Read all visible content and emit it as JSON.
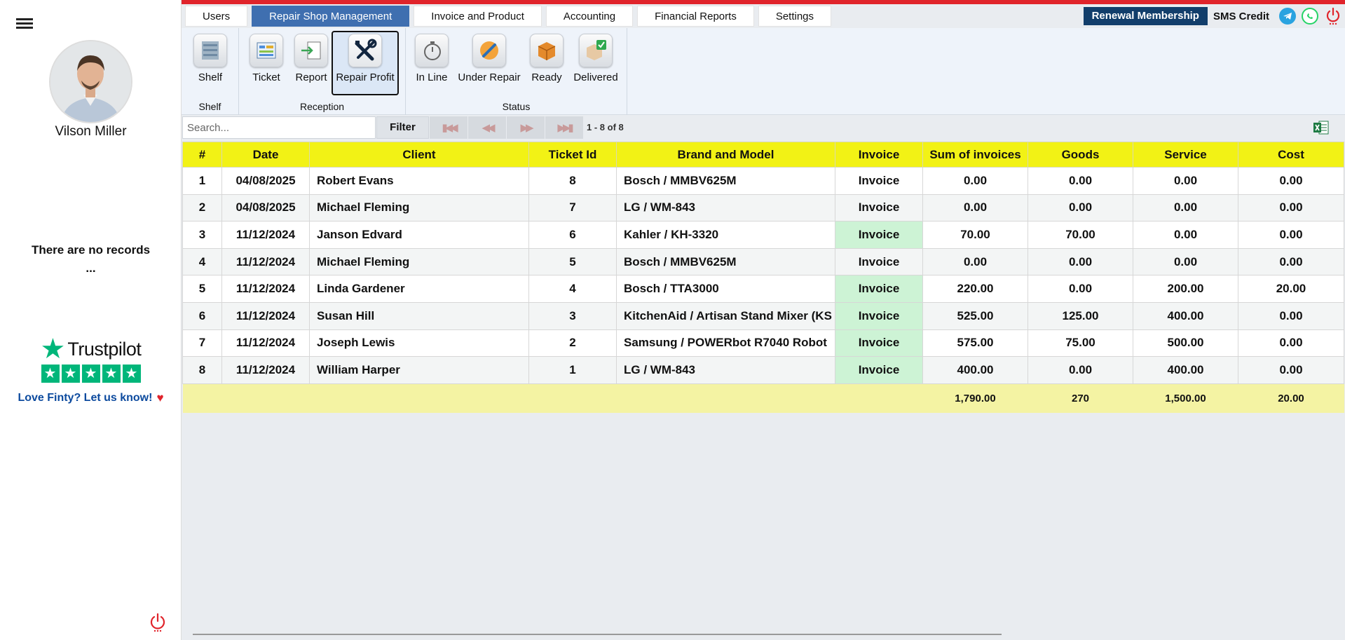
{
  "sidebar": {
    "user_name": "Vilson Miller",
    "no_records_line1": "There are no records",
    "no_records_line2": "...",
    "trustpilot_brand": "Trustpilot",
    "trustpilot_cta": "Love Finty? Let us know!"
  },
  "tabs": [
    {
      "label": "Users",
      "active": false
    },
    {
      "label": "Repair Shop Management",
      "active": true
    },
    {
      "label": "Invoice and Product",
      "active": false
    },
    {
      "label": "Accounting",
      "active": false
    },
    {
      "label": "Financial Reports",
      "active": false
    },
    {
      "label": "Settings",
      "active": false
    }
  ],
  "header": {
    "renewal_label": "Renewal Membership",
    "sms_credit_label": "SMS Credit"
  },
  "ribbon": {
    "groups": [
      {
        "label": "Shelf"
      },
      {
        "label": "Reception"
      },
      {
        "label": "Status"
      }
    ],
    "buttons": {
      "shelf": "Shelf",
      "ticket": "Ticket",
      "report": "Report",
      "repair_profit": "Repair Profit",
      "in_line": "In Line",
      "under_repair": "Under Repair",
      "ready": "Ready",
      "delivered": "Delivered"
    }
  },
  "toolbar": {
    "search_placeholder": "Search...",
    "filter_label": "Filter",
    "pager_info": "1 - 8 of 8"
  },
  "table": {
    "columns": [
      "#",
      "Date",
      "Client",
      "Ticket Id",
      "Brand and Model",
      "Invoice",
      "Sum of invoices",
      "Goods",
      "Service",
      "Cost"
    ],
    "rows": [
      {
        "num": "1",
        "date": "04/08/2025",
        "client": "Robert Evans",
        "ticket_id": "8",
        "brand_model": "Bosch / MMBV625M",
        "invoice": "Invoice",
        "invoice_highlight": false,
        "sum": "0.00",
        "goods": "0.00",
        "service": "0.00",
        "cost": "0.00"
      },
      {
        "num": "2",
        "date": "04/08/2025",
        "client": "Michael Fleming",
        "ticket_id": "7",
        "brand_model": "LG / WM-843",
        "invoice": "Invoice",
        "invoice_highlight": false,
        "sum": "0.00",
        "goods": "0.00",
        "service": "0.00",
        "cost": "0.00"
      },
      {
        "num": "3",
        "date": "11/12/2024",
        "client": "Janson Edvard",
        "ticket_id": "6",
        "brand_model": "Kahler / KH-3320",
        "invoice": "Invoice",
        "invoice_highlight": true,
        "sum": "70.00",
        "goods": "70.00",
        "service": "0.00",
        "cost": "0.00"
      },
      {
        "num": "4",
        "date": "11/12/2024",
        "client": "Michael Fleming",
        "ticket_id": "5",
        "brand_model": "Bosch / MMBV625M",
        "invoice": "Invoice",
        "invoice_highlight": false,
        "sum": "0.00",
        "goods": "0.00",
        "service": "0.00",
        "cost": "0.00"
      },
      {
        "num": "5",
        "date": "11/12/2024",
        "client": "Linda Gardener",
        "ticket_id": "4",
        "brand_model": "Bosch / TTA3000",
        "invoice": "Invoice",
        "invoice_highlight": true,
        "sum": "220.00",
        "goods": "0.00",
        "service": "200.00",
        "cost": "20.00"
      },
      {
        "num": "6",
        "date": "11/12/2024",
        "client": "Susan Hill",
        "ticket_id": "3",
        "brand_model": "KitchenAid / Artisan Stand Mixer (KS",
        "invoice": "Invoice",
        "invoice_highlight": true,
        "sum": "525.00",
        "goods": "125.00",
        "service": "400.00",
        "cost": "0.00"
      },
      {
        "num": "7",
        "date": "11/12/2024",
        "client": "Joseph Lewis",
        "ticket_id": "2",
        "brand_model": "Samsung / POWERbot R7040 Robot",
        "invoice": "Invoice",
        "invoice_highlight": true,
        "sum": "575.00",
        "goods": "75.00",
        "service": "500.00",
        "cost": "0.00"
      },
      {
        "num": "8",
        "date": "11/12/2024",
        "client": "William Harper",
        "ticket_id": "1",
        "brand_model": "LG / WM-843",
        "invoice": "Invoice",
        "invoice_highlight": true,
        "sum": "400.00",
        "goods": "0.00",
        "service": "400.00",
        "cost": "0.00"
      }
    ],
    "totals": {
      "sum": "1,790.00",
      "goods": "270",
      "service": "1,500.00",
      "cost": "20.00"
    }
  },
  "colors": {
    "accent_red": "#e0242b",
    "active_tab": "#3f6fb0",
    "renewal_bg": "#123e6b",
    "header_yellow": "#f2f215",
    "invoice_green": "#cdf3d5",
    "footer_yellow": "#f4f3a3"
  },
  "icons": [
    "menu-icon",
    "power-icon",
    "telegram-icon",
    "whatsapp-icon",
    "excel-icon",
    "first-page-icon",
    "prev-page-icon",
    "next-page-icon",
    "last-page-icon"
  ]
}
